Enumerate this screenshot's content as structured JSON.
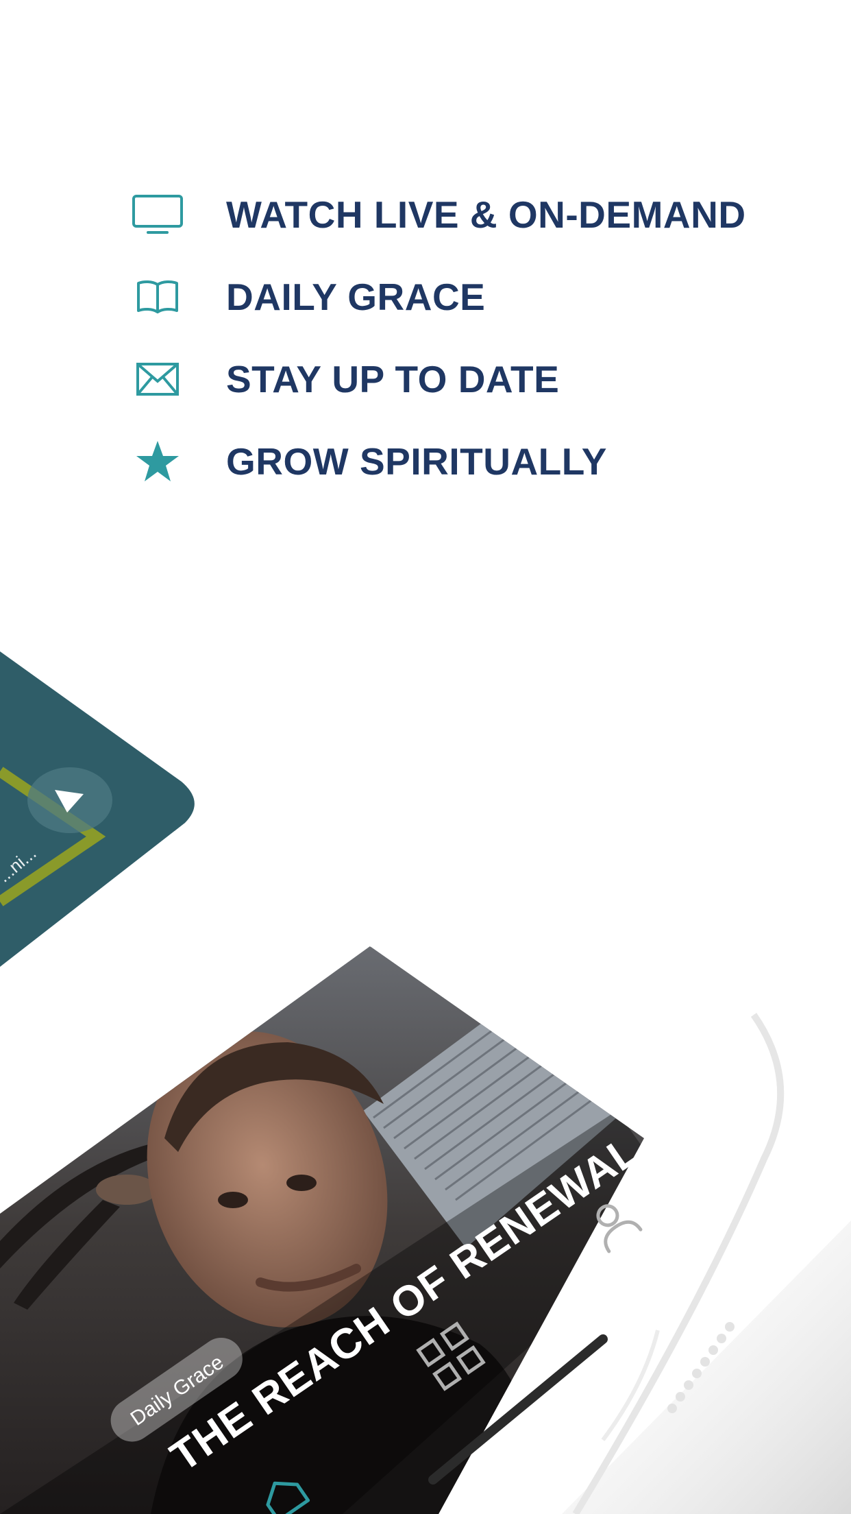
{
  "features": [
    {
      "label": "WATCH LIVE & ON-DEMAND",
      "icon": "tv-icon"
    },
    {
      "label": "DAILY GRACE",
      "icon": "book-icon"
    },
    {
      "label": "STAY UP TO DATE",
      "icon": "envelope-icon"
    },
    {
      "label": "GROW SPIRITUALLY",
      "icon": "star-icon"
    }
  ],
  "phone": {
    "top_card_caption": "...ni...",
    "video_card": {
      "title": "THE REACH OF RENEWAL",
      "badge": "Daily Grace"
    },
    "tab_bar": [
      "home-icon",
      "grid-icon",
      "profile-icon"
    ]
  },
  "colors": {
    "heading": "#1f3763",
    "icon_teal": "#2e9aa0",
    "card_teal": "#2f5d68",
    "accent_olive": "#8a9a2a"
  }
}
